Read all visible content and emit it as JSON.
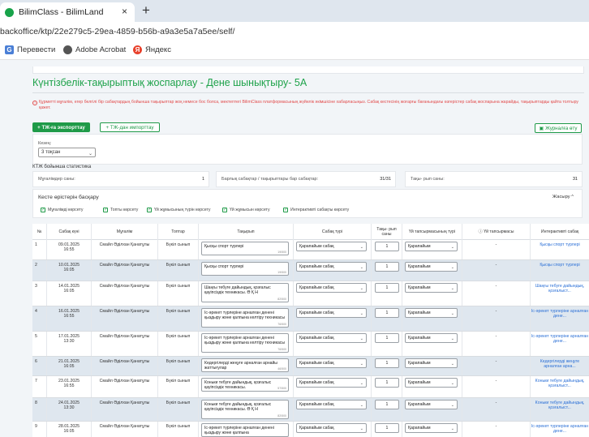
{
  "browser": {
    "tab_title": "BilimClass - BilimLand",
    "tab_close": "×",
    "new_tab": "+",
    "url": "backoffice/ktp/22e279c5-29ea-4859-b56b-a9a3e5a7a5ee/self/",
    "bookmarks": [
      {
        "label": "Перевести",
        "icon_color": "#4a7fd6"
      },
      {
        "label": "Adobe Acrobat",
        "icon_color": "#555555"
      },
      {
        "label": "Яндекс",
        "icon_color": "#e8412c"
      }
    ]
  },
  "page": {
    "title": "Күнтізбелік-тақырыптық жоспарлау - Дене шынықтыру- 5А",
    "alert": "Құрметті мұғалім, егер белгілі бір сабақтардың бойынша тақырыптар жоқ немесе бос болса, мектептегі BilimClass платформасының жүйелік әкімшісіне хабарласыңыз. Сабақ кестесінің жоғарғы бағанындағы өзгерістер сабақ жоспарына жарайды, тақырыптарды қайта толтыру қажет.",
    "buttons": {
      "export": "ТЖ-ға экспорттау",
      "import": "ТЖ-дан импорттау",
      "journal": "Журналға өту"
    },
    "period": {
      "label": "Кезең:",
      "value": "3 тоқсан"
    },
    "stats": {
      "title": "КТЖ бойынша статистика",
      "items": [
        {
          "label": "Мұғалімдер саны:",
          "value": "1"
        },
        {
          "label": "Барлық сабақтар / тақырыптары бар сабақтар:",
          "value": "31/31"
        },
        {
          "label": "Тақы- рып саны:",
          "value": "31"
        }
      ]
    },
    "settings": {
      "title": "Кесте өрістерін басқару",
      "collapse": "Жасыру",
      "checkboxes": [
        "Мұғалімді көрсету",
        "Топты көрсету",
        "Үй жұмысының түрін көрсету",
        "Үй жұмысын көрсету",
        "Интерактивті сабақты көрсету"
      ]
    },
    "table": {
      "headers": [
        "№",
        "Сабақ күні",
        "Мұғалім",
        "Топтар",
        "Тақырып",
        "Сабақ түрі",
        "Тақы- рып саны",
        "Үй тапсырмасының түрі",
        "Үй тапсырмасы",
        "Интерактивті сабақ"
      ],
      "rows": [
        {
          "no": "1",
          "date": "09.01.2025",
          "time": "16:55",
          "teacher": "Смайл Әділхан Қанатұлы",
          "group": "Бүкіл сынып",
          "topic": "Қысқы спорт түрлері",
          "counter": "19/500",
          "type": "Қарапайым сабақ",
          "count": "1",
          "hw_type": "Қарапайым",
          "hw": "-",
          "link": "Қысқы спорт түрлері"
        },
        {
          "no": "2",
          "date": "10.01.2025",
          "time": "16:05",
          "teacher": "Смайл Әділхан Қанатұлы",
          "group": "Бүкіл сынып",
          "topic": "Қысқы спорт түрлері",
          "counter": "19/500",
          "type": "Қарапайым сабақ",
          "count": "1",
          "hw_type": "Қарапайым",
          "hw": "-",
          "link": "Қысқы спорт түрлері"
        },
        {
          "no": "3",
          "date": "14.01.2025",
          "time": "16:05",
          "teacher": "Смайл Әділхан Қанатұлы",
          "group": "Бүкіл сынып",
          "topic": "Шаңғы тебуге дайындық, қозғалыс қауіпсіздік техникасы. Ө Қ Н",
          "counter": "82/500",
          "type": "Қарапайым сабақ",
          "count": "1",
          "hw_type": "Қарапайым",
          "hw": "-",
          "link": "Шаңғы тебуге дайындық, қозғалыст..."
        },
        {
          "no": "4",
          "date": "16.01.2025",
          "time": "16:55",
          "teacher": "Смайл Әділхан Қанатұлы",
          "group": "Бүкіл сынып",
          "topic": "Іс-әрекет түрлеріне арналған денені қыздыру және қалпына келтіру техникасы",
          "counter": "76/500",
          "type": "Қарапайым сабақ",
          "count": "1",
          "hw_type": "Қарапайым",
          "hw": "-",
          "link": "Іс-әрекет түрлеріне арналған дене..."
        },
        {
          "no": "5",
          "date": "17.01.2025",
          "time": "13:30",
          "teacher": "Смайл Әділхан Қанатұлы",
          "group": "Бүкіл сынып",
          "topic": "Іс-әрекет түрлеріне арналған денені қыздыру және қалпына келтіру техникасы",
          "counter": "76/500",
          "type": "Қарапайым сабақ",
          "count": "1",
          "hw_type": "Қарапайым",
          "hw": "-",
          "link": "Іс-әрекет түрлеріне арналған дене..."
        },
        {
          "no": "6",
          "date": "21.01.2025",
          "time": "16:05",
          "teacher": "Смайл Әділхан Қанатұлы",
          "group": "Бүкіл сынып",
          "topic": "Кедергілерді жеңуге арналған арнайы жаттығулар",
          "counter": "46/500",
          "type": "Қарапайым сабақ",
          "count": "1",
          "hw_type": "Қарапайым",
          "hw": "-",
          "link": "Кедергілерді жеңуге арналған арна..."
        },
        {
          "no": "7",
          "date": "23.01.2025",
          "time": "16:55",
          "teacher": "Смайл Әділхан Қанатұлы",
          "group": "Бүкіл сынып",
          "topic": "Коньки тебуге дайындық, қозғалыс қауіпсіздік техникасы.",
          "counter": "57/500",
          "type": "Қарапайым сабақ",
          "count": "1",
          "hw_type": "Қарапайым",
          "hw": "-",
          "link": "Коньки тебуге дайындық, қозғалыст..."
        },
        {
          "no": "8",
          "date": "24.01.2025",
          "time": "13:30",
          "teacher": "Смайл Әділхан Қанатұлы",
          "group": "Бүкіл сынып",
          "topic": "Коньки тебуге дайындық, қозғалыс қауіпсіздік техникасы. Ө Қ Н",
          "counter": "82/500",
          "type": "Қарапайым сабақ",
          "count": "1",
          "hw_type": "Қарапайым",
          "hw": "-",
          "link": "Коньки тебуге дайындық, қозғалыст..."
        },
        {
          "no": "9",
          "date": "28.01.2025",
          "time": "16:05",
          "teacher": "Смайл Әділхан Қанатұлы",
          "group": "Бүкіл сынып",
          "topic": "Іс-әрекет түрлеріне арналған денені қыздыру және қалпына",
          "counter": "",
          "type": "Қарапайым сабақ",
          "count": "1",
          "hw_type": "Қарапайым",
          "hw": "-",
          "link": "Іс-әрекет түрлеріне арналған дене..."
        }
      ]
    }
  },
  "colors": {
    "accent": "#1f9a48",
    "alert": "#e24b4b",
    "link": "#2a6fd6",
    "row_shade": "#dfe7ef"
  }
}
